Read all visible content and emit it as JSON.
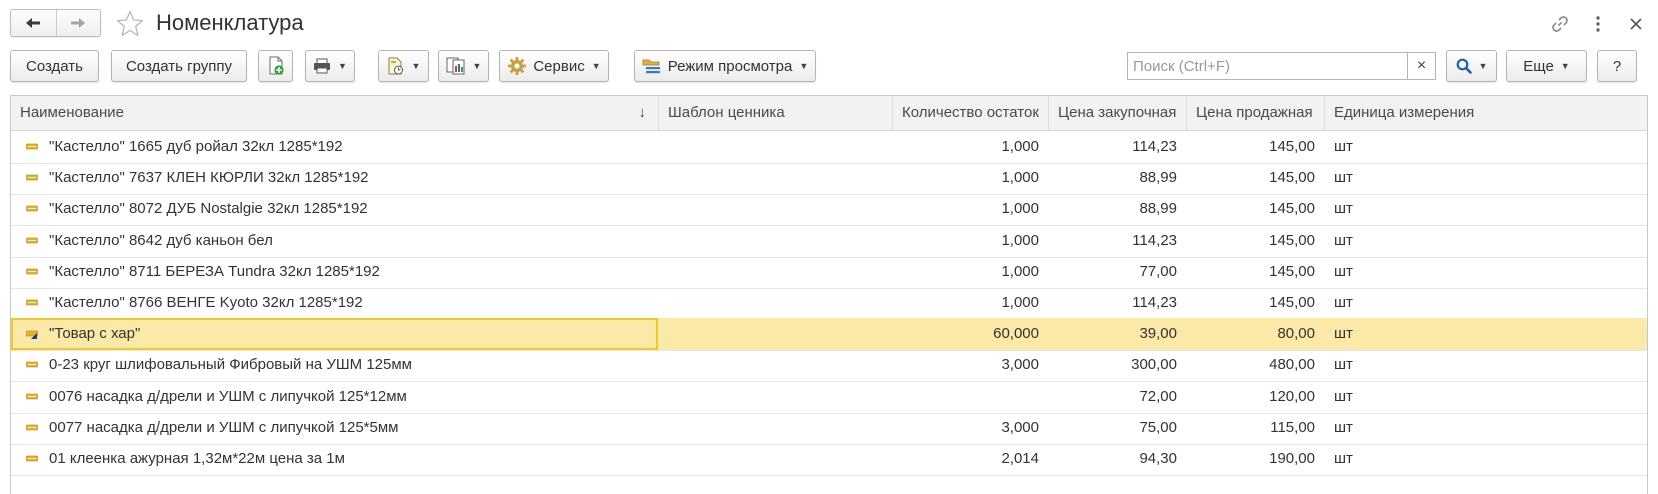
{
  "window": {
    "title": "Номенклатура"
  },
  "toolbar": {
    "create_label": "Создать",
    "create_group_label": "Создать группу",
    "service_label": "Сервис",
    "view_mode_label": "Режим просмотра",
    "more_label": "Еще",
    "help_label": "?"
  },
  "search": {
    "placeholder": "Поиск (Ctrl+F)",
    "value": "",
    "clear_label": "×"
  },
  "table": {
    "columns": [
      "Наименование",
      "Шаблон ценника",
      "Количество остаток",
      "Цена закупочная",
      "Цена продажная",
      "Единица измерения"
    ],
    "sort_indicator": "↓",
    "rows": [
      {
        "name": "\"Кастелло\" 1665 дуб ройал 32кл 1285*192",
        "template": "",
        "qty": "1,000",
        "buy": "114,23",
        "sell": "145,00",
        "unit": "шт",
        "selected": false
      },
      {
        "name": "\"Кастелло\" 7637 КЛЕН КЮРЛИ 32кл 1285*192",
        "template": "",
        "qty": "1,000",
        "buy": "88,99",
        "sell": "145,00",
        "unit": "шт",
        "selected": false
      },
      {
        "name": "\"Кастелло\" 8072 ДУБ Nostalgie 32кл 1285*192",
        "template": "",
        "qty": "1,000",
        "buy": "88,99",
        "sell": "145,00",
        "unit": "шт",
        "selected": false
      },
      {
        "name": "\"Кастелло\" 8642 дуб каньон бел",
        "template": "",
        "qty": "1,000",
        "buy": "114,23",
        "sell": "145,00",
        "unit": "шт",
        "selected": false
      },
      {
        "name": "\"Кастелло\" 8711 БЕРЕЗА Tundra 32кл 1285*192",
        "template": "",
        "qty": "1,000",
        "buy": "77,00",
        "sell": "145,00",
        "unit": "шт",
        "selected": false
      },
      {
        "name": "\"Кастелло\" 8766 ВЕНГЕ Kyoto 32кл 1285*192",
        "template": "",
        "qty": "1,000",
        "buy": "114,23",
        "sell": "145,00",
        "unit": "шт",
        "selected": false
      },
      {
        "name": "\"Товар с хар\"",
        "template": "",
        "qty": "60,000",
        "buy": "39,00",
        "sell": "80,00",
        "unit": "шт",
        "selected": true
      },
      {
        "name": "0-23 круг шлифовальный Фибровый на УШМ 125мм",
        "template": "",
        "qty": "3,000",
        "buy": "300,00",
        "sell": "480,00",
        "unit": "шт",
        "selected": false
      },
      {
        "name": "0076 насадка д/дрели и УШМ с липучкой 125*12мм",
        "template": "",
        "qty": "",
        "buy": "72,00",
        "sell": "120,00",
        "unit": "шт",
        "selected": false
      },
      {
        "name": "0077 насадка д/дрели и УШМ с липучкой 125*5мм",
        "template": "",
        "qty": "3,000",
        "buy": "75,00",
        "sell": "115,00",
        "unit": "шт",
        "selected": false
      },
      {
        "name": "01 клеенка ажурная 1,32м*22м цена за 1м",
        "template": "",
        "qty": "2,014",
        "buy": "94,30",
        "sell": "190,00",
        "unit": "шт",
        "selected": false
      }
    ]
  },
  "icons": {
    "back": "arrow-left-icon",
    "forward": "arrow-right-icon",
    "favorite": "star-icon",
    "link": "link-icon",
    "menu": "kebab-menu-icon",
    "close": "close-icon",
    "add_copy": "add-copy-icon",
    "print": "printer-icon",
    "report": "report-icon",
    "structure": "structure-icon",
    "service": "gear-icon",
    "view_mode": "view-mode-icon",
    "search": "search-icon",
    "item": "item-icon",
    "item_characteristics": "item-characteristics-icon"
  },
  "colors": {
    "selected_row": "#fbe9a8",
    "focus_border": "#f3c62e",
    "item_icon": "#e8b423",
    "search_icon": "#1a5fb4",
    "header_bg": "#f2f2f2"
  }
}
